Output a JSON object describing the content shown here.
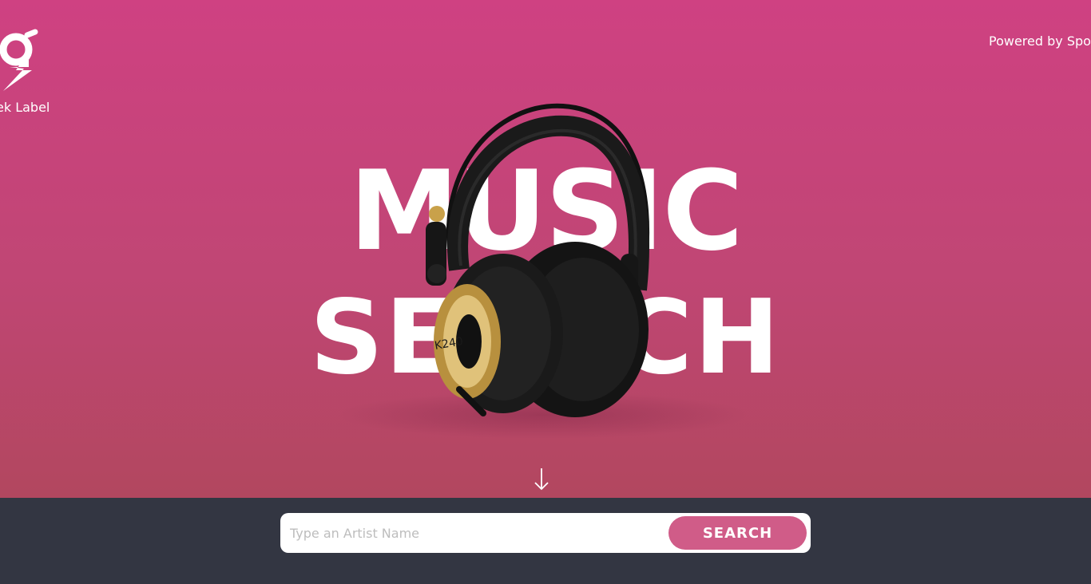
{
  "header": {
    "logo_label": "ek Label",
    "powered_by": "Powered by Spo"
  },
  "hero": {
    "title_line1": "MUSIC",
    "title_line2": "SEARCH",
    "scroll_icon": "arrow-down-icon",
    "image": "headphones-icon"
  },
  "search": {
    "placeholder": "Type an Artist Name",
    "button_label": "SEARCH"
  },
  "colors": {
    "hero_top": "#cf4182",
    "hero_bottom": "#b2475f",
    "footer_bg": "#333642",
    "button": "#d05c88"
  }
}
